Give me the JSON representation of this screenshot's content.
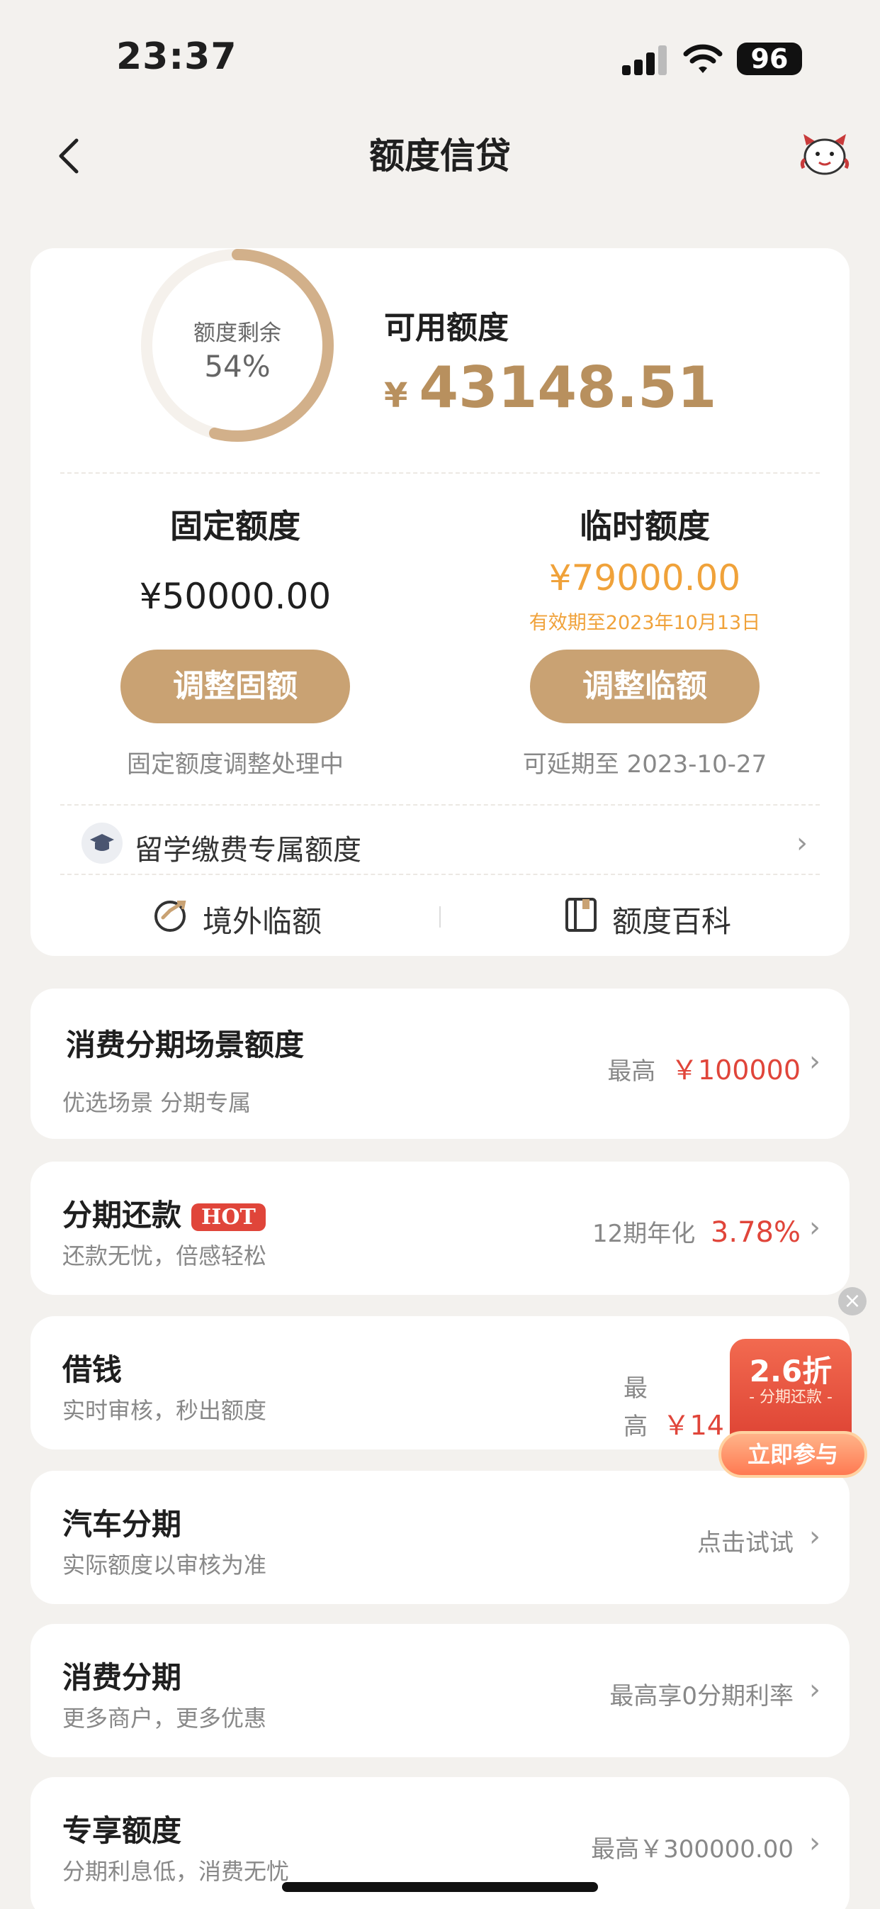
{
  "status_bar": {
    "time": "23:37",
    "battery": "96"
  },
  "header": {
    "title": "额度信贷"
  },
  "credit": {
    "remaining_label": "额度剩余",
    "remaining_percent": "54%",
    "remaining_fraction": 0.54,
    "available_label": "可用额度",
    "available_currency": "¥",
    "available_amount": "43148.51",
    "fixed": {
      "title": "固定额度",
      "amount": "¥50000.00",
      "button": "调整固额",
      "note": "固定额度调整处理中"
    },
    "temp": {
      "title": "临时额度",
      "amount": "¥79000.00",
      "validity": "有效期至2023年10月13日",
      "button": "调整临额",
      "note": "可延期至 2023-10-27"
    },
    "study_abroad": "留学缴费专属额度",
    "links": {
      "overseas": "境外临额",
      "encyclopedia": "额度百科"
    }
  },
  "items": [
    {
      "title": "消费分期场景额度",
      "subtitle": "优选场景 分期专属",
      "right_prefix": "最高",
      "right_value": "￥100000"
    },
    {
      "title": "分期还款",
      "badge": "HOT",
      "subtitle": "还款无忧，倍感轻松",
      "right_prefix": "12期年化",
      "right_value": "3.78%"
    },
    {
      "title": "借钱",
      "subtitle": "实时审核，秒出额度",
      "right_prefix": "最高",
      "right_value": "￥14"
    },
    {
      "title": "汽车分期",
      "subtitle": "实际额度以审核为准",
      "right_text": "点击试试"
    },
    {
      "title": "消费分期",
      "subtitle": "更多商户，更多优惠",
      "right_text": "最高享0分期利率"
    },
    {
      "title": "专享额度",
      "subtitle": "分期利息低，消费无忧",
      "right_text": "最高￥300000.00"
    }
  ],
  "promo": {
    "discount": "2.6折",
    "subtitle": "- 分期还款 -",
    "button": "立即参与"
  },
  "colors": {
    "gold": "#b8905e",
    "button_gold": "#c9a273",
    "temp_amount": "#f0a23a",
    "red": "#e0453a"
  }
}
